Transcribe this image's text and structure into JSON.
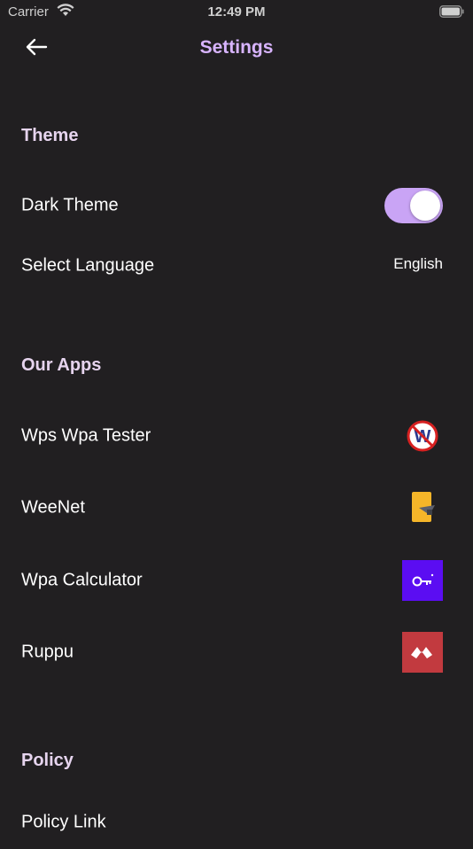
{
  "status_bar": {
    "carrier": "Carrier",
    "time": "12:49 PM",
    "wifi_icon": "wifi-icon",
    "battery_icon": "battery-icon"
  },
  "nav": {
    "title": "Settings",
    "back_icon": "arrow-left-icon",
    "title_color": "#d8b4fe"
  },
  "sections": {
    "theme": {
      "header": "Theme",
      "dark_theme_label": "Dark Theme",
      "dark_theme_enabled": true,
      "language_label": "Select Language",
      "language_value": "English"
    },
    "our_apps": {
      "header": "Our Apps",
      "apps": [
        {
          "label": "Wps Wpa Tester",
          "icon": "wps-wpa-tester-icon"
        },
        {
          "label": "WeeNet",
          "icon": "weenet-icon"
        },
        {
          "label": "Wpa Calculator",
          "icon": "wpa-calculator-icon"
        },
        {
          "label": "Ruppu",
          "icon": "ruppu-icon"
        }
      ]
    },
    "policy": {
      "header": "Policy",
      "policy_link_label": "Policy Link"
    }
  },
  "colors": {
    "background": "#211f21",
    "accent": "#c9a4f5",
    "section_header": "#e6d4ee"
  }
}
